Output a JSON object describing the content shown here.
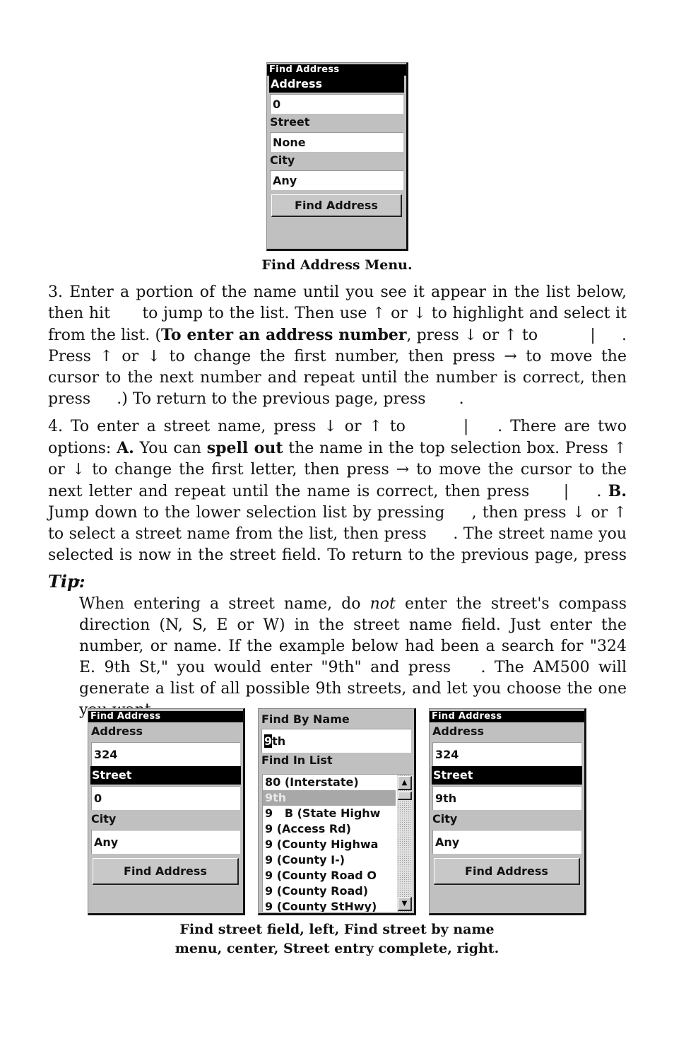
{
  "figure_top": {
    "title": "Find Address",
    "fields": [
      {
        "label": "Address",
        "value": "0",
        "selected": true
      },
      {
        "label": "Street",
        "value": "None",
        "selected": false
      },
      {
        "label": "City",
        "value": "Any",
        "selected": false
      }
    ],
    "button": "Find Address",
    "caption": "Find Address Menu."
  },
  "step3": {
    "t1": "3. Enter a portion of the name until you see it appear in the list below, then hit ",
    "t2": " to jump to the list. Then use ↑ or ↓ to highlight and select it from the list. (",
    "bold1": "To enter an address number",
    "t3": ", press ↓ or ↑ to ",
    "t4": " | ",
    "t5": ". Press ↑ or ↓ to change the first number, then press → to move the cursor to the next number and repeat until the number is correct, then press ",
    "t6": ".) To return to the previous page, press ",
    "t7": "."
  },
  "step4": {
    "t1": "4. To enter a street name, press ↓ or ↑ to ",
    "t2": " | ",
    "t3": ". There are two options: ",
    "boldA": "A.",
    "t4": " You can ",
    "bold_spell": "spell out",
    "t5": " the name in the top selection box. Press ↑ or ↓ to change the first letter, then press → to move the cursor to the next letter and repeat until the name is correct, then press ",
    "t6": " | ",
    "t7": ". ",
    "boldB": "B.",
    "t8": " Jump down to the lower selection list by pressing ",
    "t9": ", then press ↓ or ↑ to select a street name from the list, then press ",
    "t10": ". The street name you selected is now in the street field. To return to the previous page, press ",
    "t11": "."
  },
  "tip": {
    "heading": "Tip:",
    "t1": "When entering a street name, do ",
    "italic": "not",
    "t2": " enter the street's compass direction (N, S, E or W) in the street name field. Just enter the number, or name. If the example below had been a search for \"324 E. 9th St,\" you would enter \"9th\" and press ",
    "t3": ". The AM500 will generate a list of all possible 9th streets, and let you choose the one you want."
  },
  "figure_left": {
    "title": "Find Address",
    "fields": [
      {
        "label": "Address",
        "value": "324"
      },
      {
        "label": "Street",
        "value": "0"
      },
      {
        "label": "City",
        "value": "Any"
      }
    ],
    "button": "Find Address"
  },
  "figure_mid": {
    "label_name": "Find By Name",
    "input_cursor": "9",
    "input_rest": "th",
    "label_list": "Find In List",
    "list": [
      "80 (Interstate)",
      "9th",
      "9   B (State Highw",
      "9 (Access Rd)",
      "9 (County Highwa",
      "9 (County I-)",
      "9 (County Road O",
      "9 (County Road)",
      "9 (County StHwy)"
    ],
    "highlighted_index": 1,
    "scroll_up": "▲",
    "scroll_down": "▼"
  },
  "figure_right": {
    "title": "Find Address",
    "fields": [
      {
        "label": "Address",
        "value": "324"
      },
      {
        "label": "Street",
        "value": "9th"
      },
      {
        "label": "City",
        "value": "Any"
      }
    ],
    "button": "Find Address"
  },
  "bottom_caption": {
    "line1": "Find street field, left, Find street by name",
    "line2": "menu, center, Street entry complete, right."
  }
}
